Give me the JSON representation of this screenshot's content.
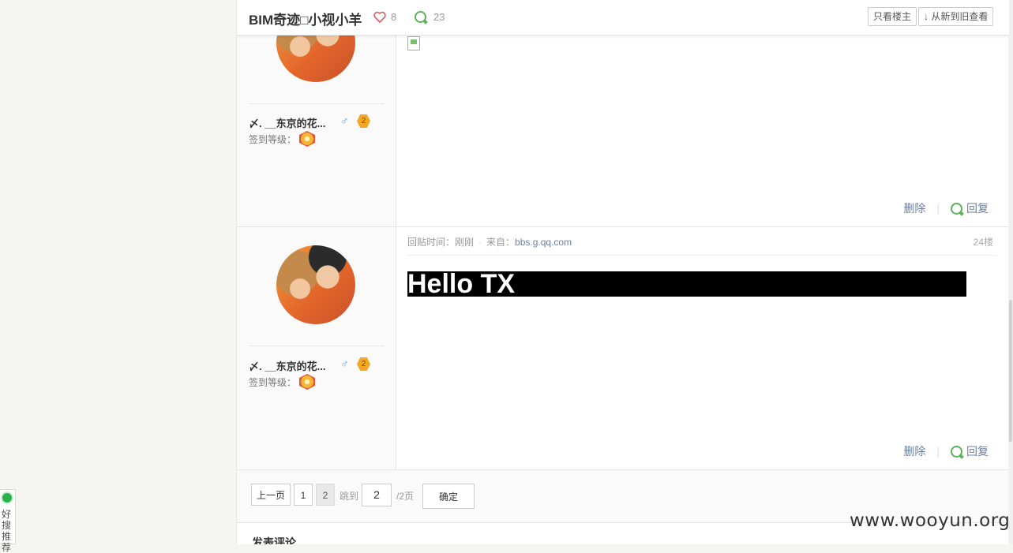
{
  "header": {
    "title": "BIM奇迹□小视小羊",
    "likes": "8",
    "comments": "23",
    "only_op_label": "只看楼主",
    "sort_label": "↓ 从新到旧查看"
  },
  "posts": [
    {
      "username": "〆. __东京的花...",
      "gender_symbol": "♂",
      "level": "2",
      "sign_level_label": "签到等级：",
      "delete_label": "删除",
      "reply_label": "回复"
    },
    {
      "username": "〆. __东京的花...",
      "gender_symbol": "♂",
      "level": "2",
      "sign_level_label": "签到等级：",
      "time_label": "回贴时间：刚刚",
      "source_label": "来自：",
      "source_value": "bbs.g.qq.com",
      "floor": "24楼",
      "content": "Hello TX",
      "delete_label": "删除",
      "reply_label": "回复"
    }
  ],
  "pager": {
    "prev_label": "上一页",
    "pages": [
      "1",
      "2"
    ],
    "jump_label": "跳到",
    "jump_value": "2",
    "total_label": "/2页",
    "confirm_label": "确定"
  },
  "comment_section_title": "发表评论",
  "side_widget": {
    "label": "好搜推荐"
  },
  "watermark": "www.wooyun.org",
  "colors": {
    "link": "#6b7f9e",
    "reply_icon": "#5ab35a",
    "like_icon": "#e05a5a",
    "badge": "#f5a623"
  }
}
